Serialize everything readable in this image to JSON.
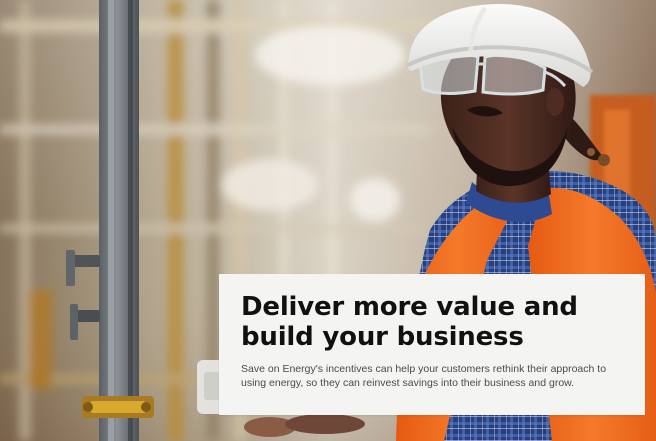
{
  "hero": {
    "image": {
      "alt": "",
      "icon": "photo-worker-hardhat-safety-vest"
    },
    "headline": "Deliver more value and build your business",
    "description": "Save on Energy's incentives can help your customers rethink their approach to using energy, so they can reinvest savings into their business and grow."
  },
  "colors": {
    "card_background": "#f4f4f2",
    "headline_text": "#111111",
    "body_text": "#4b4b4b",
    "vest_orange": "#f36b1c",
    "helmet_white": "#f2f2f0"
  }
}
